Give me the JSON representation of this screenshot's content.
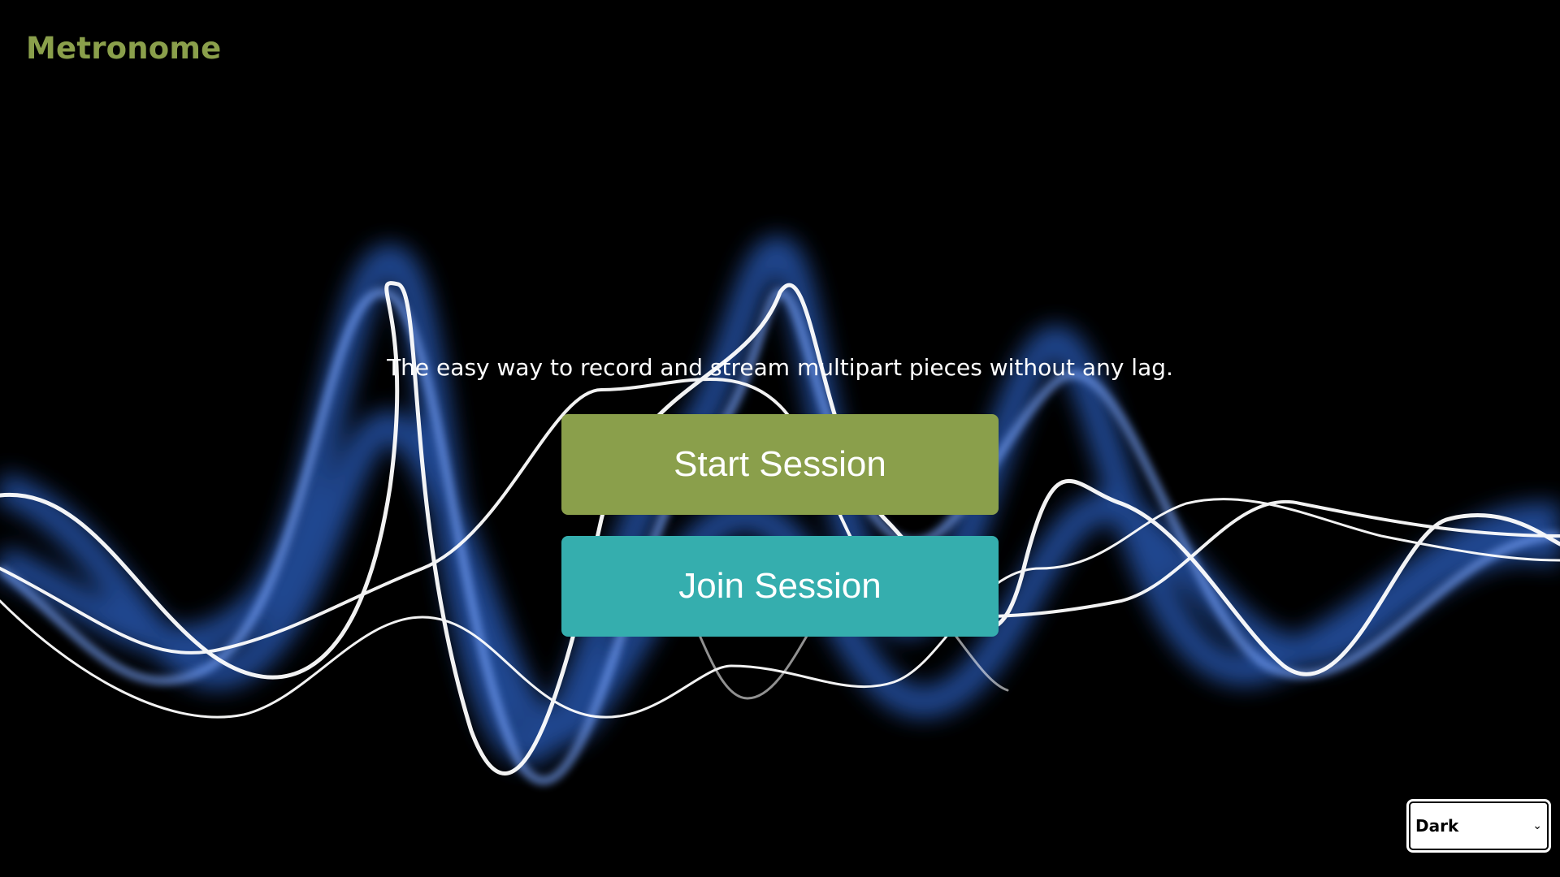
{
  "app": {
    "title": "Metronome"
  },
  "hero": {
    "tagline": "The easy way to record and stream multipart pieces without any lag."
  },
  "actions": {
    "start_label": "Start Session",
    "join_label": "Join Session"
  },
  "theme": {
    "selected": "Dark",
    "icon": "chevron-down-icon"
  },
  "colors": {
    "brand": "#8a9f4b",
    "start_button": "#8a9f4b",
    "join_button": "#35aeae",
    "background": "#000000"
  }
}
